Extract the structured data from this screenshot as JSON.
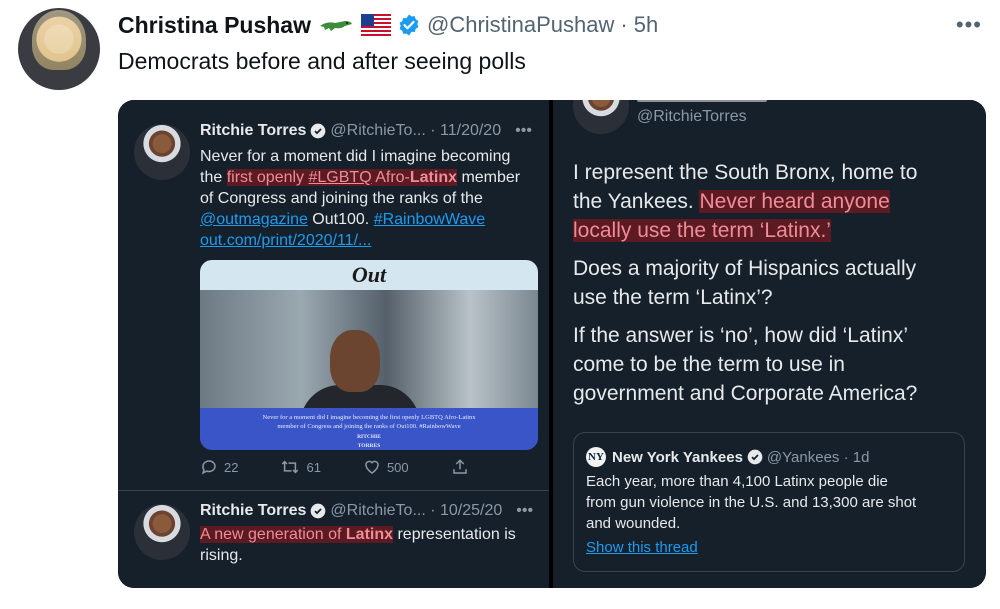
{
  "tweet": {
    "author_name": "Christina Pushaw",
    "handle": "@ChristinaPushaw",
    "time": "5h",
    "text": "Democrats before and after seeing polls",
    "more": "•••",
    "emoji": [
      "alligator-emoji",
      "us-flag-emoji"
    ]
  },
  "embedded": {
    "left_tweet_1": {
      "name": "Ritchie Torres",
      "meta": "@RitchieTo... · 11/20/20",
      "more": "•••",
      "text_1": "Never for a moment did I imagine becoming",
      "text_2a": "the ",
      "hl_a": "first openly ",
      "hl_link": "#LGBTQ",
      "hl_b": " Afro-",
      "hl_bold": "Latinx",
      "text_2b": " member",
      "text_3": "of Congress and joining the ranks of the",
      "link_1": "@outmagazine",
      "text_4": " Out100. ",
      "link_2": "#RainbowWave",
      "link_3": "out.com/print/2020/11/...",
      "card_title": "Out",
      "card_caption_1": "Never for a moment did I imagine becoming the first openly LGBTQ Afro-Latinx",
      "card_caption_2": "member of Congress and joining the ranks of Out100. #RainbowWave",
      "card_sig_1": "RITCHIE",
      "card_sig_2": "TORRES",
      "reply_count": "22",
      "retweet_count": "61",
      "like_count": "500"
    },
    "left_tweet_2": {
      "name": "Ritchie Torres",
      "meta": "@RitchieTo... · 10/25/20",
      "more": "•••",
      "hl_a": "A new generation of ",
      "hl_bold": "Latinx",
      "text_a": " representation is",
      "text_b": "rising."
    },
    "right_tweet": {
      "handle": "@RitchieTorres",
      "p1_a": "I represent the South Bronx, home to",
      "p1_b": "the Yankees. ",
      "p1_hl_1": "Never heard anyone",
      "p1_hl_2": "locally use the term ‘Latinx.’",
      "p2_a": "Does a majority of Hispanics actually",
      "p2_b": "use the term ‘Latinx’?",
      "p3_a": "If the answer is ‘no’, how did ‘Latinx’",
      "p3_b": "come to be the term to use in",
      "p3_c": "government and Corporate America?",
      "quote": {
        "logo": "NY",
        "name": "New York Yankees",
        "meta": "@Yankees · 1d",
        "text_1": "Each year, more than 4,100 Latinx people die",
        "text_2": "from gun violence in the U.S. and 13,300 are shot",
        "text_3": "and wounded.",
        "link": "Show this thread"
      }
    }
  },
  "colors": {
    "verified": "#1d9bf0",
    "dark_bg": "#15202b",
    "highlight_bg": "#5c1a22",
    "highlight_text": "#f08c96"
  }
}
